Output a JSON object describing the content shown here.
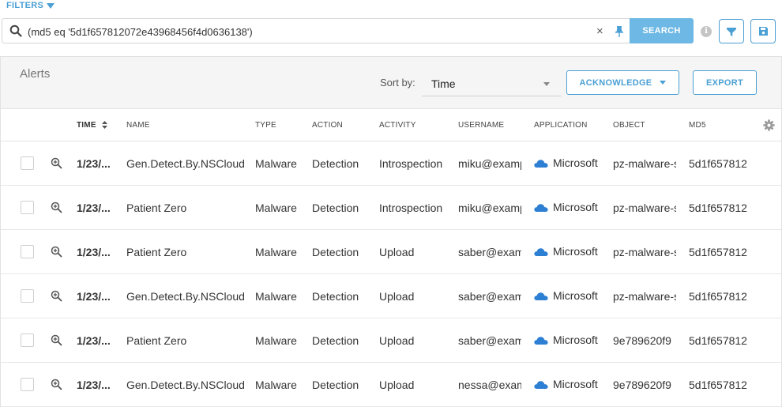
{
  "filters": {
    "label": "FILTERS"
  },
  "search": {
    "query": "(md5 eq '5d1f657812072e43968456f4d0636138')",
    "clear": "×",
    "button_label": "SEARCH",
    "info": "i"
  },
  "alerts": {
    "title": "Alerts",
    "sort_label": "Sort by:",
    "sort_value": "Time",
    "acknowledge_label": "ACKNOWLEDGE",
    "export_label": "EXPORT"
  },
  "columns": {
    "time": "TIME",
    "name": "NAME",
    "type": "TYPE",
    "action": "ACTION",
    "activity": "ACTIVITY",
    "username": "USERNAME",
    "application": "APPLICATION",
    "object": "OBJECT",
    "md5": "MD5"
  },
  "rows": [
    {
      "time": "1/23/...",
      "name": "Gen.Detect.By.NSCloud",
      "type": "Malware",
      "action": "Detection",
      "activity": "Introspection",
      "username": "miku@examp",
      "application": "Microsoft",
      "object": "pz-malware-s",
      "md5": "5d1f657812"
    },
    {
      "time": "1/23/...",
      "name": "Patient Zero",
      "type": "Malware",
      "action": "Detection",
      "activity": "Introspection",
      "username": "miku@examp",
      "application": "Microsoft",
      "object": "pz-malware-s",
      "md5": "5d1f657812"
    },
    {
      "time": "1/23/...",
      "name": "Patient Zero",
      "type": "Malware",
      "action": "Detection",
      "activity": "Upload",
      "username": "saber@exam",
      "application": "Microsoft",
      "object": "pz-malware-s",
      "md5": "5d1f657812"
    },
    {
      "time": "1/23/...",
      "name": "Gen.Detect.By.NSCloud",
      "type": "Malware",
      "action": "Detection",
      "activity": "Upload",
      "username": "saber@exam",
      "application": "Microsoft",
      "object": "pz-malware-s",
      "md5": "5d1f657812"
    },
    {
      "time": "1/23/...",
      "name": "Patient Zero",
      "type": "Malware",
      "action": "Detection",
      "activity": "Upload",
      "username": "saber@exam",
      "application": "Microsoft",
      "object": "9e789620f9",
      "md5": "5d1f657812"
    },
    {
      "time": "1/23/...",
      "name": "Gen.Detect.By.NSCloud",
      "type": "Malware",
      "action": "Detection",
      "activity": "Upload",
      "username": "nessa@exam",
      "application": "Microsoft",
      "object": "9e789620f9",
      "md5": "5d1f657812"
    }
  ],
  "colors": {
    "accent": "#4a9fd4",
    "search_button": "#6db8e4",
    "cloud": "#2d7fd3"
  },
  "icons": [
    "search-icon",
    "clear-icon",
    "pin-icon",
    "info-icon",
    "funnel-icon",
    "save-icon",
    "sort-icon",
    "gear-icon",
    "zoom-in-icon",
    "cloud-icon"
  ]
}
